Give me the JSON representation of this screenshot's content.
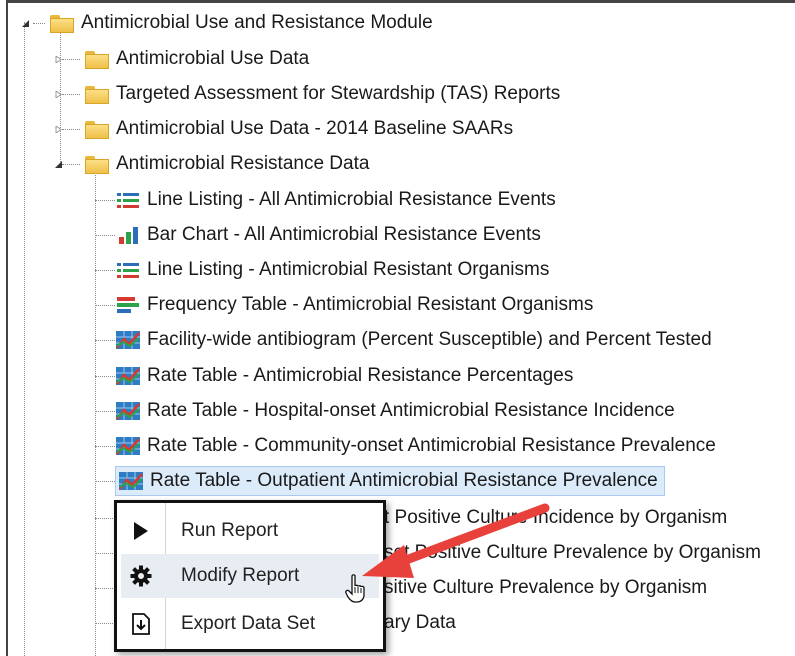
{
  "tree": {
    "root_label": "Antimicrobial Use and Resistance Module",
    "folders": [
      {
        "label": "Antimicrobial Use Data"
      },
      {
        "label": "Targeted Assessment for Stewardship (TAS) Reports"
      },
      {
        "label": "Antimicrobial Use Data - 2014 Baseline SAARs"
      },
      {
        "label": "Antimicrobial Resistance Data"
      }
    ],
    "reports": [
      {
        "label": "Line Listing - All Antimicrobial Resistance Events",
        "icon": "list-icon"
      },
      {
        "label": "Bar Chart - All Antimicrobial Resistance Events",
        "icon": "bar-chart-icon"
      },
      {
        "label": "Line Listing - Antimicrobial Resistant Organisms",
        "icon": "list-icon"
      },
      {
        "label": "Frequency Table - Antimicrobial Resistant Organisms",
        "icon": "frequency-table-icon"
      },
      {
        "label": "Facility-wide antibiogram (Percent Susceptible) and Percent Tested",
        "icon": "rate-table-icon"
      },
      {
        "label": "Rate Table - Antimicrobial Resistance Percentages",
        "icon": "rate-table-icon"
      },
      {
        "label": "Rate Table - Hospital-onset Antimicrobial Resistance Incidence",
        "icon": "rate-table-icon"
      },
      {
        "label": "Rate Table - Community-onset Antimicrobial Resistance Prevalence",
        "icon": "rate-table-icon"
      },
      {
        "label": "Rate Table - Outpatient Antimicrobial Resistance Prevalence",
        "icon": "rate-table-icon"
      }
    ],
    "partial_rows": [
      {
        "label": "t Positive Culture Incidence by Organism"
      },
      {
        "label": "set Positive Culture Prevalence by Organism"
      },
      {
        "label": "sitive Culture Prevalence by Organism"
      },
      {
        "label": "ary Data"
      }
    ]
  },
  "context_menu": {
    "items": [
      {
        "label": "Run Report",
        "icon": "play-icon"
      },
      {
        "label": "Modify Report",
        "icon": "gear-icon"
      },
      {
        "label": "Export Data Set",
        "icon": "export-icon"
      }
    ]
  },
  "colors": {
    "selection": "#dcebfa",
    "arrow": "#e8413c",
    "folder": "#f0c04a"
  }
}
